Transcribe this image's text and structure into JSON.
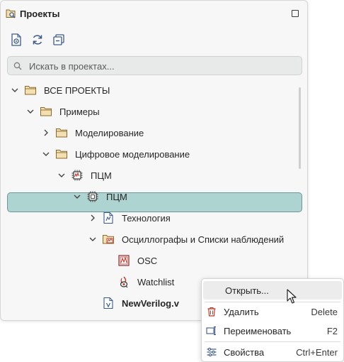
{
  "panel": {
    "title": "Проекты",
    "title_icon": "projects-search-icon",
    "toolbar": [
      {
        "name": "new-project-icon"
      },
      {
        "name": "refresh-icon"
      },
      {
        "name": "collapse-all-icon"
      }
    ]
  },
  "search": {
    "placeholder": "Искать в проектах..."
  },
  "tree": {
    "items": [
      {
        "label": "ВСЕ ПРОЕКТЫ",
        "icon": "folder-icon",
        "expanded": true
      },
      {
        "label": "Примеры",
        "icon": "folder-icon",
        "expanded": true
      },
      {
        "label": "Моделирование",
        "icon": "folder-icon",
        "expanded": false
      },
      {
        "label": "Цифровое моделирование",
        "icon": "folder-icon",
        "expanded": true
      },
      {
        "label": "ПЦМ",
        "icon": "chip-project-icon",
        "expanded": true
      },
      {
        "label": "ПЦМ",
        "icon": "chip-icon",
        "expanded": true
      },
      {
        "label": "Технология",
        "icon": "technology-file-icon",
        "expanded": false
      },
      {
        "label": "Осциллографы и Списки наблюдений",
        "icon": "oscilloscope-folder-icon",
        "expanded": true
      },
      {
        "label": "OSC",
        "icon": "oscilloscope-icon"
      },
      {
        "label": "Watchlist",
        "icon": "watchlist-icon",
        "selected": true
      },
      {
        "label": "NewVerilog.v",
        "icon": "verilog-file-icon",
        "bold": true
      }
    ]
  },
  "context_menu": {
    "items": [
      {
        "label": "Открыть...",
        "shortcut": "",
        "icon": ""
      },
      {
        "label": "Удалить",
        "shortcut": "Delete",
        "icon": "trash-icon"
      },
      {
        "label": "Переименовать",
        "shortcut": "F2",
        "icon": "rename-icon"
      },
      {
        "label": "Свойства",
        "shortcut": "Ctrl+Enter",
        "icon": "properties-icon"
      }
    ]
  },
  "colors": {
    "selection": "#aed4d2",
    "folder": "#e8c98a",
    "accent_red": "#c0392b",
    "icon_blue": "#3a5a8c"
  }
}
